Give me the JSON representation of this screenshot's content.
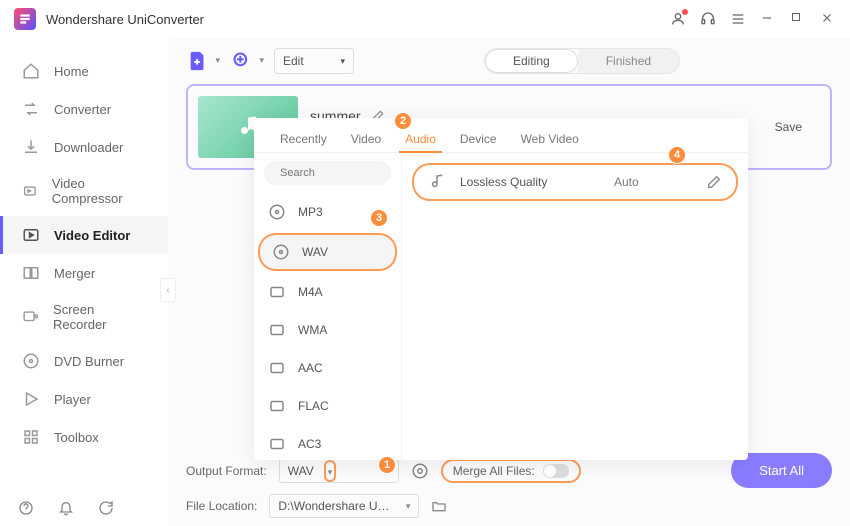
{
  "app": {
    "title": "Wondershare UniConverter"
  },
  "sidebar": {
    "items": [
      {
        "label": "Home"
      },
      {
        "label": "Converter"
      },
      {
        "label": "Downloader"
      },
      {
        "label": "Video Compressor"
      },
      {
        "label": "Video Editor"
      },
      {
        "label": "Merger"
      },
      {
        "label": "Screen Recorder"
      },
      {
        "label": "DVD Burner"
      },
      {
        "label": "Player"
      },
      {
        "label": "Toolbox"
      }
    ]
  },
  "toolbar": {
    "edit_label": "Edit"
  },
  "segmented": {
    "editing": "Editing",
    "finished": "Finished"
  },
  "track": {
    "name": "summer",
    "save": "Save"
  },
  "popup": {
    "tabs": [
      "Recently",
      "Video",
      "Audio",
      "Device",
      "Web Video"
    ],
    "search_placeholder": "Search",
    "formats": [
      "MP3",
      "WAV",
      "M4A",
      "WMA",
      "AAC",
      "FLAC",
      "AC3"
    ],
    "quality": {
      "label": "Lossless Quality",
      "auto": "Auto"
    }
  },
  "bottom": {
    "output_format_label": "Output Format:",
    "output_format_value": "WAV",
    "merge_label": "Merge All Files:",
    "start_all": "Start All",
    "file_location_label": "File Location:",
    "file_location_value": "D:\\Wondershare UniConverter"
  },
  "badges": {
    "b1": "1",
    "b2": "2",
    "b3": "3",
    "b4": "4"
  }
}
